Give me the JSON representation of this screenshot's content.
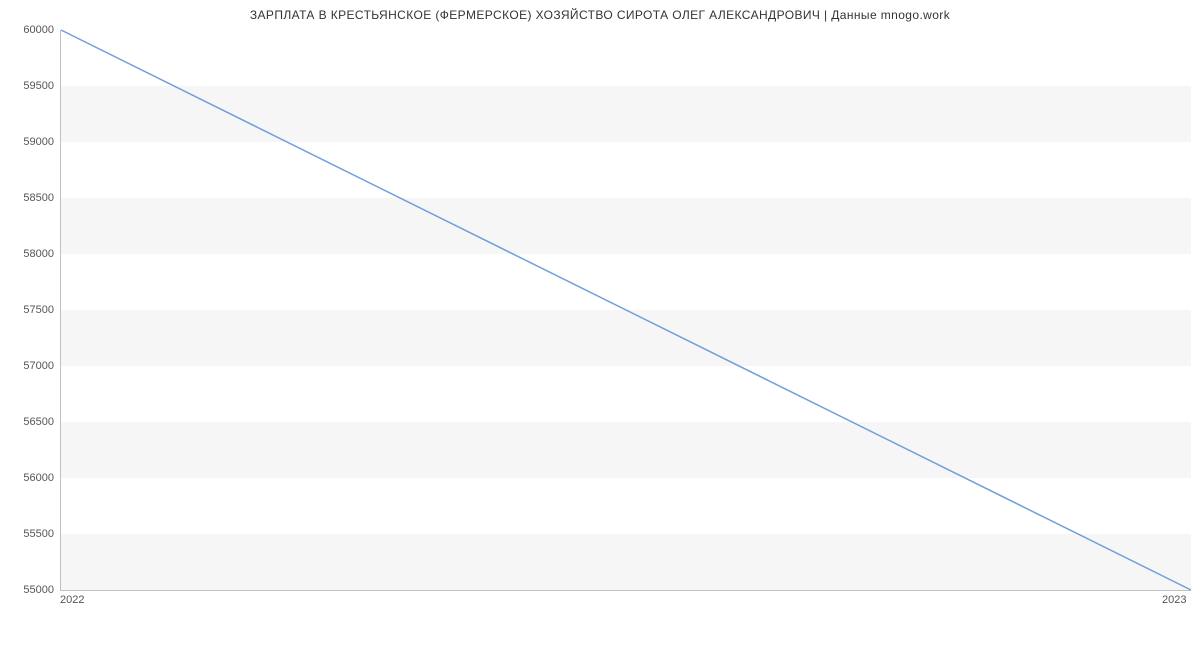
{
  "chart_data": {
    "type": "line",
    "title": "ЗАРПЛАТА В КРЕСТЬЯНСКОЕ (ФЕРМЕРСКОЕ) ХОЗЯЙСТВО СИРОТА ОЛЕГ АЛЕКСАНДРОВИЧ | Данные mnogo.work",
    "x": [
      2022,
      2023
    ],
    "values": [
      60000,
      55000
    ],
    "xlabel": "",
    "ylabel": "",
    "xlim": [
      2022,
      2023
    ],
    "ylim": [
      55000,
      60000
    ],
    "x_ticks": [
      2022,
      2023
    ],
    "y_ticks": [
      55000,
      55500,
      56000,
      56500,
      57000,
      57500,
      58000,
      58500,
      59000,
      59500,
      60000
    ],
    "line_color": "#6f9ede"
  }
}
